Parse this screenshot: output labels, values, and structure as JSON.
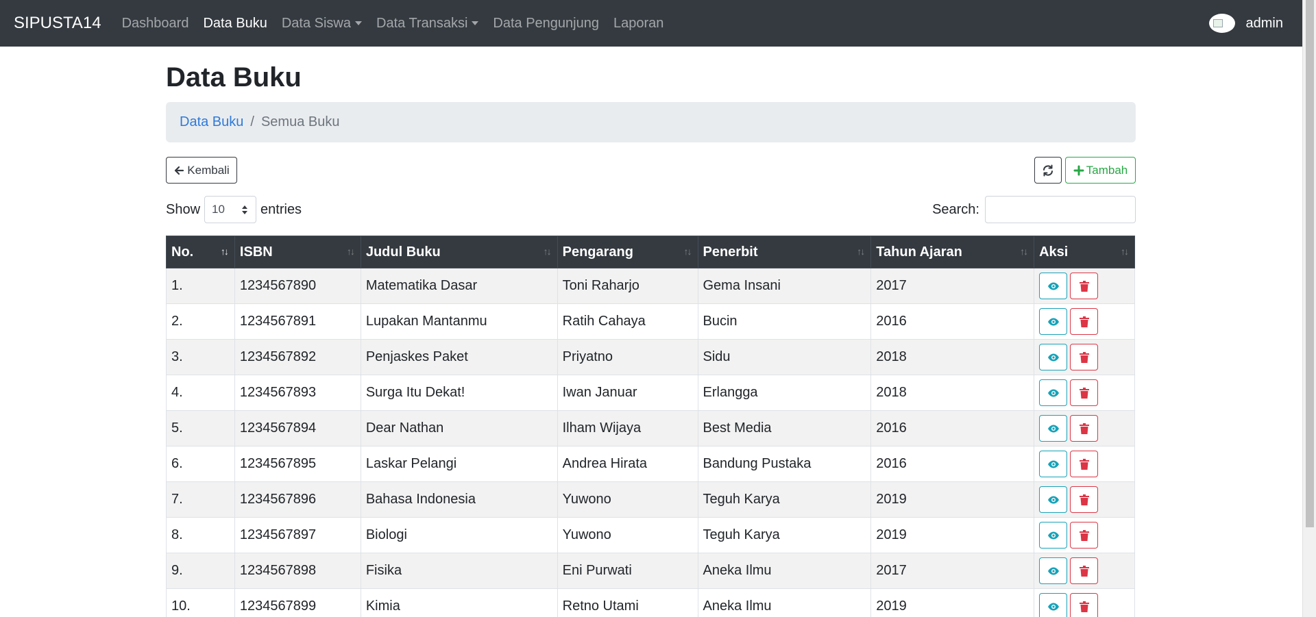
{
  "navbar": {
    "brand": "SIPUSTA14",
    "items": [
      {
        "label": "Dashboard",
        "active": false,
        "dropdown": false
      },
      {
        "label": "Data Buku",
        "active": true,
        "dropdown": false
      },
      {
        "label": "Data Siswa",
        "active": false,
        "dropdown": true
      },
      {
        "label": "Data Transaksi",
        "active": false,
        "dropdown": true
      },
      {
        "label": "Data Pengunjung",
        "active": false,
        "dropdown": false
      },
      {
        "label": "Laporan",
        "active": false,
        "dropdown": false
      }
    ],
    "user": "admin"
  },
  "page": {
    "title": "Data Buku",
    "breadcrumb": {
      "link": "Data Buku",
      "separator": "/",
      "current": "Semua Buku"
    }
  },
  "toolbar": {
    "back_label": "Kembali",
    "add_label": "Tambah"
  },
  "controls": {
    "show_label": "Show",
    "entries_value": "10",
    "entries_label": "entries",
    "search_label": "Search:",
    "search_value": ""
  },
  "table": {
    "columns": [
      "No.",
      "ISBN",
      "Judul Buku",
      "Pengarang",
      "Penerbit",
      "Tahun Ajaran",
      "Aksi"
    ],
    "sorted_column": "No.",
    "rows": [
      {
        "no": "1.",
        "isbn": "1234567890",
        "judul": "Matematika Dasar",
        "pengarang": "Toni Raharjo",
        "penerbit": "Gema Insani",
        "tahun": "2017"
      },
      {
        "no": "2.",
        "isbn": "1234567891",
        "judul": "Lupakan Mantanmu",
        "pengarang": "Ratih Cahaya",
        "penerbit": "Bucin",
        "tahun": "2016"
      },
      {
        "no": "3.",
        "isbn": "1234567892",
        "judul": "Penjaskes Paket",
        "pengarang": "Priyatno",
        "penerbit": "Sidu",
        "tahun": "2018"
      },
      {
        "no": "4.",
        "isbn": "1234567893",
        "judul": "Surga Itu Dekat!",
        "pengarang": "Iwan Januar",
        "penerbit": "Erlangga",
        "tahun": "2018"
      },
      {
        "no": "5.",
        "isbn": "1234567894",
        "judul": "Dear Nathan",
        "pengarang": "Ilham Wijaya",
        "penerbit": "Best Media",
        "tahun": "2016"
      },
      {
        "no": "6.",
        "isbn": "1234567895",
        "judul": "Laskar Pelangi",
        "pengarang": "Andrea Hirata",
        "penerbit": "Bandung Pustaka",
        "tahun": "2016"
      },
      {
        "no": "7.",
        "isbn": "1234567896",
        "judul": "Bahasa Indonesia",
        "pengarang": "Yuwono",
        "penerbit": "Teguh Karya",
        "tahun": "2019"
      },
      {
        "no": "8.",
        "isbn": "1234567897",
        "judul": "Biologi",
        "pengarang": "Yuwono",
        "penerbit": "Teguh Karya",
        "tahun": "2019"
      },
      {
        "no": "9.",
        "isbn": "1234567898",
        "judul": "Fisika",
        "pengarang": "Eni Purwati",
        "penerbit": "Aneka Ilmu",
        "tahun": "2017"
      },
      {
        "no": "10.",
        "isbn": "1234567899",
        "judul": "Kimia",
        "pengarang": "Retno Utami",
        "penerbit": "Aneka Ilmu",
        "tahun": "2019"
      }
    ]
  },
  "icons": {
    "back": "arrow-left-icon",
    "refresh": "refresh-icon",
    "add": "plus-icon",
    "view": "eye-icon",
    "delete": "trash-icon",
    "sort": "sort-icon"
  },
  "colors": {
    "navbar": "#343a40",
    "link": "#2f7ad9",
    "success": "#28a745",
    "info": "#17a2b8",
    "danger": "#dc3545",
    "stripe": "#f2f2f2"
  }
}
